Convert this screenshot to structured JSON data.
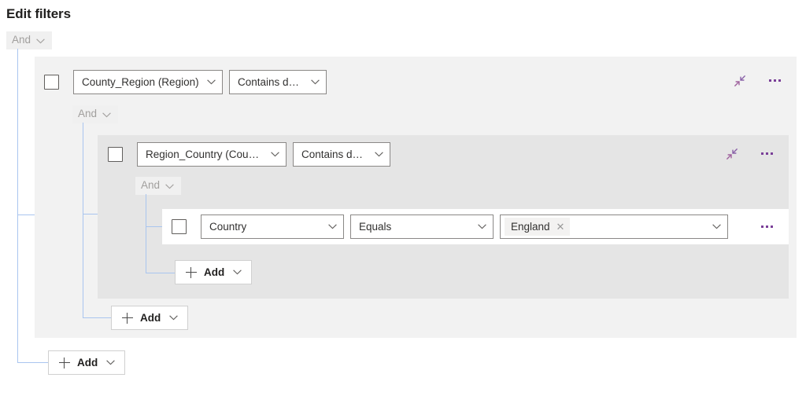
{
  "page": {
    "title": "Edit filters"
  },
  "root": {
    "operator": "And",
    "operator_icon": "chevron-down-icon",
    "add_label": "Add"
  },
  "groups": [
    {
      "level": 1,
      "field": "County_Region (Region)",
      "condition": "Contains data",
      "operator": "And",
      "collapse_icon": "collapse-arrows-icon",
      "more_icon": "ellipsis-icon",
      "add_label": "Add"
    },
    {
      "level": 2,
      "field": "Region_Country (Count...",
      "condition": "Contains data",
      "operator": "And",
      "collapse_icon": "collapse-arrows-icon",
      "more_icon": "ellipsis-icon",
      "add_label": "Add"
    }
  ],
  "leaf": {
    "field": "Country",
    "condition": "Equals",
    "value_token": "England",
    "remove_token_icon": "close-icon",
    "value_dropdown_icon": "chevron-down-icon",
    "more_icon": "ellipsis-icon",
    "add_label": "Add"
  },
  "colors": {
    "connector_line": "#a9c5ef",
    "level1_bg": "#f2f2f2",
    "level2_bg": "#e5e5e5",
    "level3_bg": "#ffffff",
    "accent_purple": "#7a3f98",
    "disabled_text": "#a19f9d"
  }
}
